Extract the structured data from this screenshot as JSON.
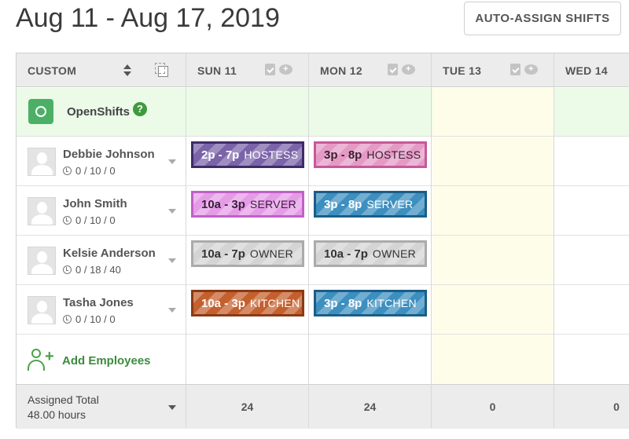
{
  "header": {
    "title": "Aug 11 - Aug 17, 2019",
    "auto_assign_label": "AUTO-ASSIGN SHIFTS"
  },
  "columns": {
    "sort_label": "CUSTOM",
    "days": [
      {
        "label": "SUN 11"
      },
      {
        "label": "MON 12"
      },
      {
        "label": "TUE 13"
      },
      {
        "label": "WED 14"
      }
    ]
  },
  "open_shifts": {
    "label": "OpenShifts",
    "help": "?"
  },
  "employees": [
    {
      "name": "Debbie Johnson",
      "hours": "0 / 10 / 0"
    },
    {
      "name": "John Smith",
      "hours": "0 / 10 / 0"
    },
    {
      "name": "Kelsie Anderson",
      "hours": "0 / 18 / 40"
    },
    {
      "name": "Tasha Jones",
      "hours": "0 / 10 / 0"
    }
  ],
  "shifts": [
    {
      "time": "2p - 7p",
      "role": "HOSTESS",
      "fill": "#7a63a8",
      "border": "#3d2d66",
      "text": "#ffffff"
    },
    {
      "time": "3p - 8p",
      "role": "HOSTESS",
      "fill": "#e59ac6",
      "border": "#c8589a",
      "text": "#3a2030"
    },
    {
      "time": "10a - 3p",
      "role": "SERVER",
      "fill": "#e59ce6",
      "border": "#c05fc8",
      "text": "#3a1f3d"
    },
    {
      "time": "3p - 8p",
      "role": "SERVER",
      "fill": "#3c8fbf",
      "border": "#1a5e88",
      "text": "#ffffff"
    },
    {
      "time": "10a - 7p",
      "role": "OWNER",
      "fill": "#d4d4d4",
      "border": "#ababab",
      "text": "#333333"
    },
    {
      "time": "10a - 7p",
      "role": "OWNER",
      "fill": "#d4d4d4",
      "border": "#ababab",
      "text": "#333333"
    },
    {
      "time": "10a - 3p",
      "role": "KITCHEN",
      "fill": "#c4602d",
      "border": "#8a3a14",
      "text": "#ffffff"
    },
    {
      "time": "3p - 8p",
      "role": "KITCHEN",
      "fill": "#3c8fbf",
      "border": "#1a5e88",
      "text": "#ffffff"
    }
  ],
  "add_employees": {
    "label": "Add Employees"
  },
  "totals": {
    "label": "Assigned Total",
    "hours": "48.00 hours",
    "values": [
      "24",
      "24",
      "0",
      "0"
    ]
  },
  "colors": {
    "open_row_bg": "#ebfbe8",
    "today_col_bg": "#fdfdea",
    "accent_green": "#4aa34a"
  }
}
